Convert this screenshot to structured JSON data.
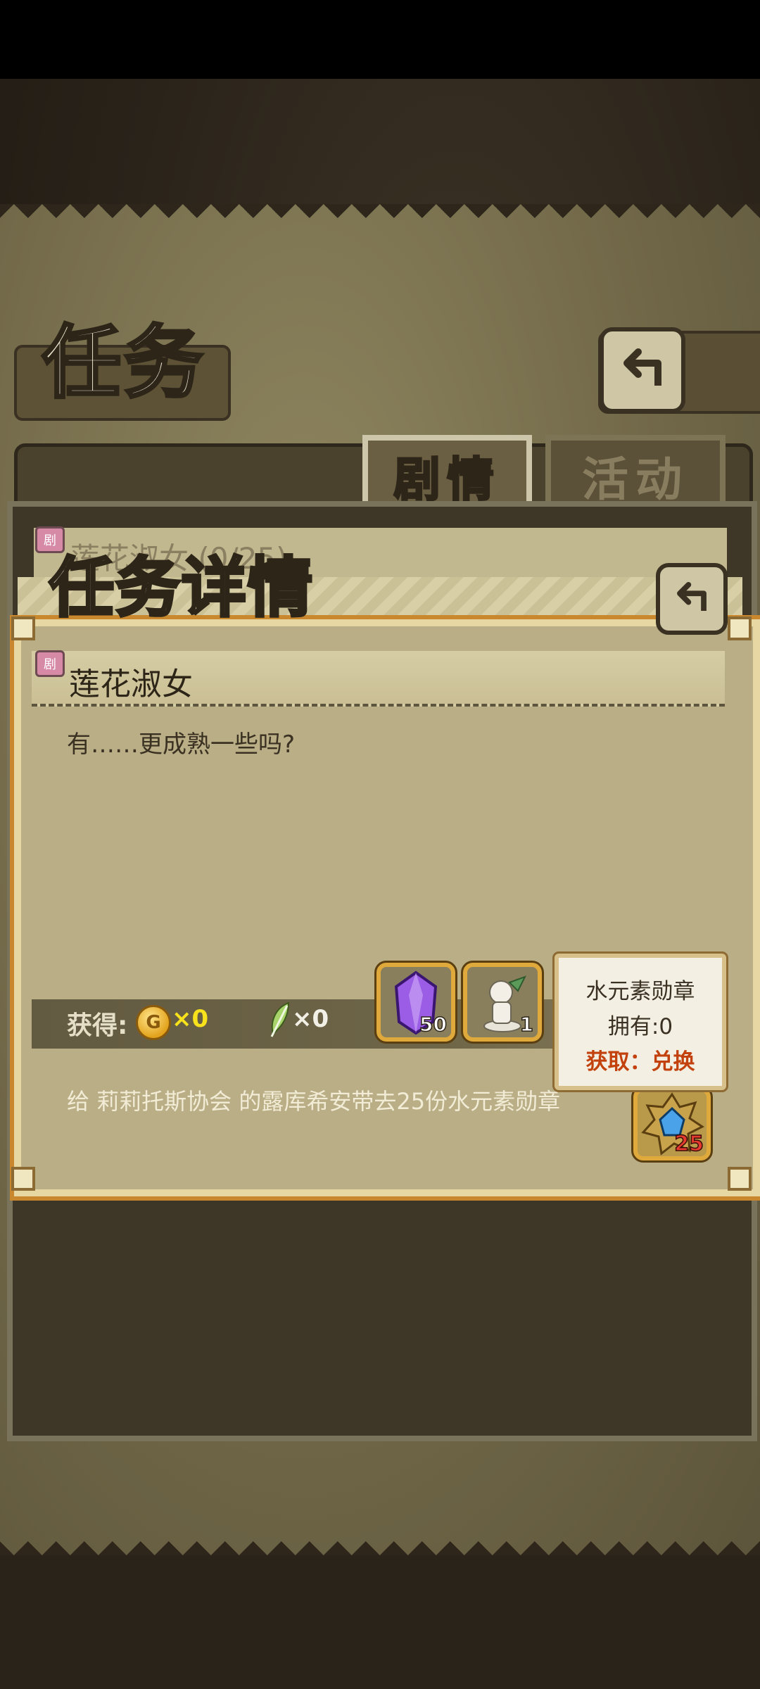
{
  "header": {
    "title": "任务"
  },
  "tabs": [
    {
      "label": "剧情",
      "active": true
    },
    {
      "label": "活动",
      "active": false
    }
  ],
  "task_list": {
    "row": {
      "badge": "剧",
      "title": "莲花淑女 (0/25)"
    }
  },
  "dialog": {
    "title": "任务详情",
    "task_badge": "剧",
    "task_name": "莲花淑女",
    "description": "有……更成熟一些吗?",
    "rewards": {
      "label": "获得:",
      "gold_icon_letter": "G",
      "gold_count": "×0",
      "feather_count": "×0",
      "items": [
        {
          "icon": "purple-crystal-icon",
          "count": "50"
        },
        {
          "icon": "figurine-icon",
          "count": "1"
        }
      ]
    },
    "objective": "给 莉莉托斯协会 的露库希安带去25份水元素勋章",
    "required_item": {
      "icon": "water-medal-icon",
      "count": "25"
    },
    "tooltip": {
      "item_name": "水元素勋章",
      "owned": "拥有:0",
      "source": "获取：兑换"
    }
  },
  "colors": {
    "accent_gold": "#e0a93c",
    "gold_text": "#f7e21b",
    "source_text": "#c2410c",
    "count_red": "#e43a2f"
  }
}
